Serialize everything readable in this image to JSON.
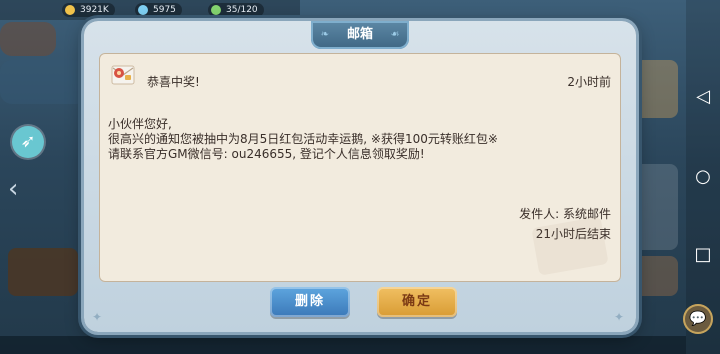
{
  "topbar": {
    "resources": [
      {
        "value": "3921K",
        "color": "#f0c24b"
      },
      {
        "value": "5975",
        "color": "#7fd0f3"
      },
      {
        "value": "35/120",
        "color": "#84d46f"
      }
    ]
  },
  "mailbox": {
    "title": "邮箱",
    "subject": "恭喜中奖!",
    "time_ago": "2小时前",
    "body_lines": [
      "小伙伴您好,",
      "很高兴的通知您被抽中为8月5日红包活动幸运鹅, ※获得100元转账红包※",
      "请联系官方GM微信号: ou246655, 登记个人信息领取奖励!"
    ],
    "sender": "发件人: 系统邮件",
    "expiry": "21小时后结束",
    "delete_label": "删除",
    "confirm_label": "确定"
  },
  "colors": {
    "modal_bg": "#c9d7e2",
    "inner_bg": "#f2ebde",
    "delete_btn": "#4b8fcd",
    "confirm_btn": "#e4ac45"
  },
  "icons": [
    "rocket-icon",
    "mail-icon",
    "chat-icon",
    "back-icon",
    "home-icon",
    "recents-icon"
  ]
}
